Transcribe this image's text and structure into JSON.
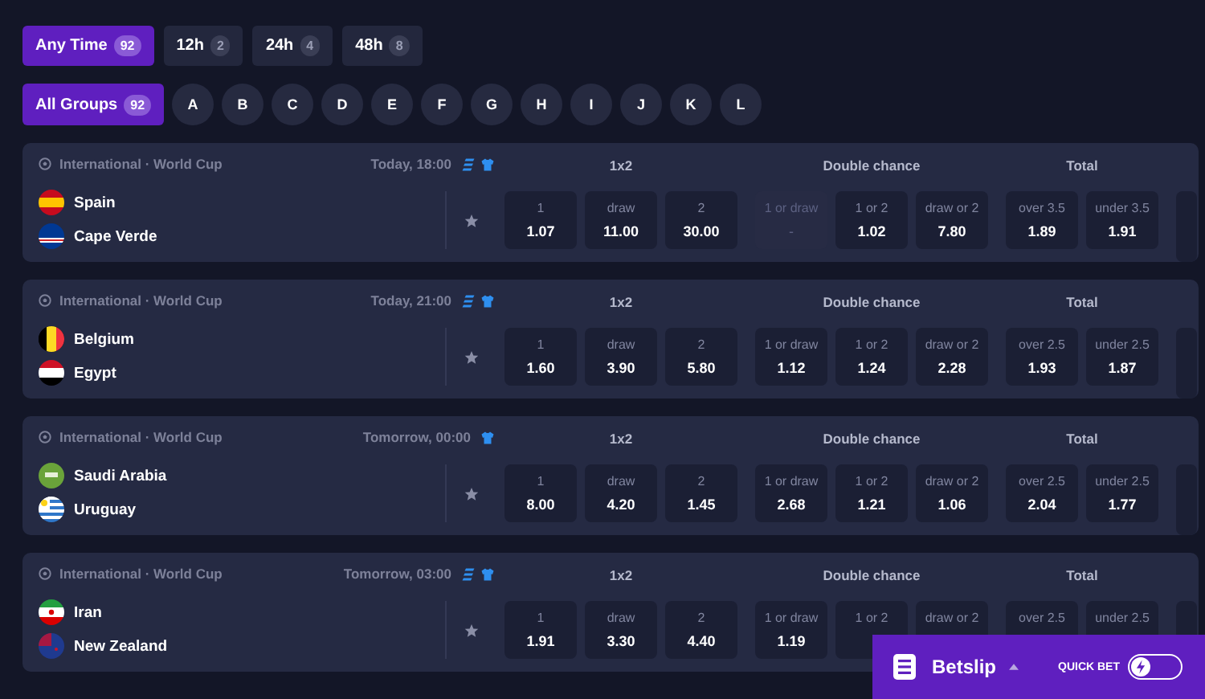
{
  "time_filters": [
    {
      "label": "Any Time",
      "count": "92",
      "selected": true
    },
    {
      "label": "12h",
      "count": "2",
      "selected": false
    },
    {
      "label": "24h",
      "count": "4",
      "selected": false
    },
    {
      "label": "48h",
      "count": "8",
      "selected": false
    }
  ],
  "group_filters": [
    {
      "label": "All Groups",
      "count": "92",
      "selected": true
    },
    {
      "label": "A",
      "selected": false
    },
    {
      "label": "B",
      "selected": false
    },
    {
      "label": "C",
      "selected": false
    },
    {
      "label": "D",
      "selected": false
    },
    {
      "label": "E",
      "selected": false
    },
    {
      "label": "F",
      "selected": false
    },
    {
      "label": "G",
      "selected": false
    },
    {
      "label": "H",
      "selected": false
    },
    {
      "label": "I",
      "selected": false
    },
    {
      "label": "J",
      "selected": false
    },
    {
      "label": "K",
      "selected": false
    },
    {
      "label": "L",
      "selected": false
    }
  ],
  "matches": [
    {
      "league": "International · World Cup",
      "time": "Today, 18:00",
      "stats_icon": true,
      "shirt_icon": true,
      "teams": [
        "Spain",
        "Cape Verde"
      ],
      "markets": [
        {
          "title": "1x2",
          "odds": [
            {
              "label": "1",
              "value": "1.07",
              "disabled": false
            },
            {
              "label": "draw",
              "value": "11.00",
              "disabled": false
            },
            {
              "label": "2",
              "value": "30.00",
              "disabled": false
            }
          ]
        },
        {
          "title": "Double chance",
          "odds": [
            {
              "label": "1 or draw",
              "value": "-",
              "disabled": true
            },
            {
              "label": "1 or 2",
              "value": "1.02",
              "disabled": false
            },
            {
              "label": "draw or 2",
              "value": "7.80",
              "disabled": false
            }
          ]
        },
        {
          "title": "Total",
          "odds": [
            {
              "label": "over 3.5",
              "value": "1.89",
              "disabled": false
            },
            {
              "label": "under 3.5",
              "value": "1.91",
              "disabled": false
            }
          ]
        }
      ]
    },
    {
      "league": "International · World Cup",
      "time": "Today, 21:00",
      "stats_icon": true,
      "shirt_icon": true,
      "teams": [
        "Belgium",
        "Egypt"
      ],
      "markets": [
        {
          "title": "1x2",
          "odds": [
            {
              "label": "1",
              "value": "1.60",
              "disabled": false
            },
            {
              "label": "draw",
              "value": "3.90",
              "disabled": false
            },
            {
              "label": "2",
              "value": "5.80",
              "disabled": false
            }
          ]
        },
        {
          "title": "Double chance",
          "odds": [
            {
              "label": "1 or draw",
              "value": "1.12",
              "disabled": false
            },
            {
              "label": "1 or 2",
              "value": "1.24",
              "disabled": false
            },
            {
              "label": "draw or 2",
              "value": "2.28",
              "disabled": false
            }
          ]
        },
        {
          "title": "Total",
          "odds": [
            {
              "label": "over 2.5",
              "value": "1.93",
              "disabled": false
            },
            {
              "label": "under 2.5",
              "value": "1.87",
              "disabled": false
            }
          ]
        }
      ]
    },
    {
      "league": "International · World Cup",
      "time": "Tomorrow, 00:00",
      "stats_icon": false,
      "shirt_icon": true,
      "teams": [
        "Saudi Arabia",
        "Uruguay"
      ],
      "markets": [
        {
          "title": "1x2",
          "odds": [
            {
              "label": "1",
              "value": "8.00",
              "disabled": false
            },
            {
              "label": "draw",
              "value": "4.20",
              "disabled": false
            },
            {
              "label": "2",
              "value": "1.45",
              "disabled": false
            }
          ]
        },
        {
          "title": "Double chance",
          "odds": [
            {
              "label": "1 or draw",
              "value": "2.68",
              "disabled": false
            },
            {
              "label": "1 or 2",
              "value": "1.21",
              "disabled": false
            },
            {
              "label": "draw or 2",
              "value": "1.06",
              "disabled": false
            }
          ]
        },
        {
          "title": "Total",
          "odds": [
            {
              "label": "over 2.5",
              "value": "2.04",
              "disabled": false
            },
            {
              "label": "under 2.5",
              "value": "1.77",
              "disabled": false
            }
          ]
        }
      ]
    },
    {
      "league": "International · World Cup",
      "time": "Tomorrow, 03:00",
      "stats_icon": true,
      "shirt_icon": true,
      "teams": [
        "Iran",
        "New Zealand"
      ],
      "markets": [
        {
          "title": "1x2",
          "odds": [
            {
              "label": "1",
              "value": "1.91",
              "disabled": false
            },
            {
              "label": "draw",
              "value": "3.30",
              "disabled": false
            },
            {
              "label": "2",
              "value": "4.40",
              "disabled": false
            }
          ]
        },
        {
          "title": "Double chance",
          "odds": [
            {
              "label": "1 or draw",
              "value": "1.19",
              "disabled": false
            },
            {
              "label": "1 or 2",
              "disabled": false
            },
            {
              "label": "draw or 2",
              "disabled": false
            }
          ]
        },
        {
          "title": "Total",
          "odds": [
            {
              "label": "over 2.5",
              "disabled": false
            },
            {
              "label": "under 2.5",
              "disabled": false
            }
          ]
        }
      ]
    }
  ],
  "betslip": {
    "title": "Betslip",
    "quick_bet_label": "QUICK BET",
    "quick_bet_on": false
  }
}
